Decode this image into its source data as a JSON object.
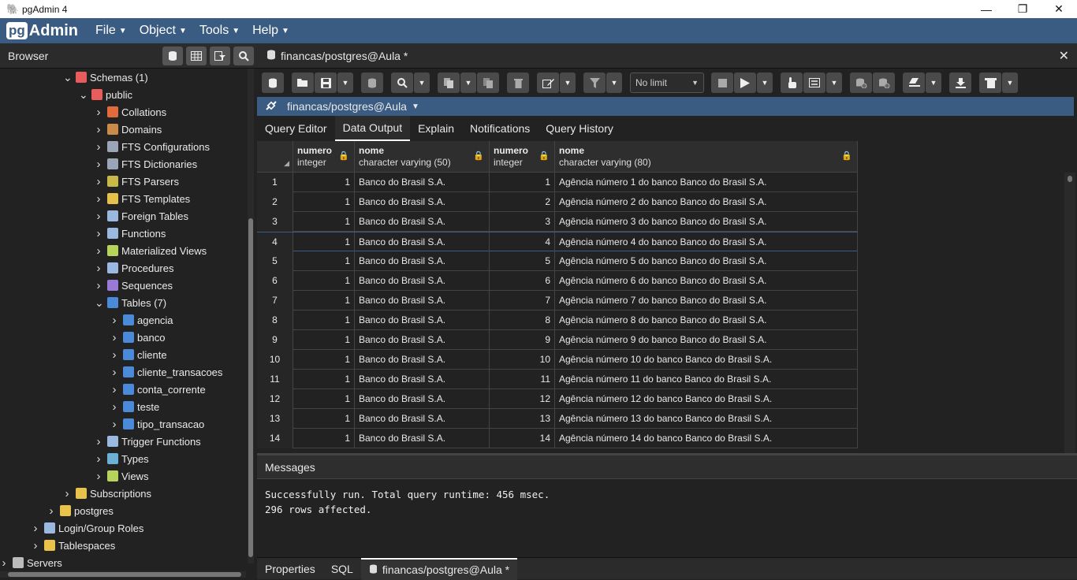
{
  "window": {
    "title": "pgAdmin 4",
    "minimize": "—",
    "restore": "❐",
    "close": "✕"
  },
  "app": {
    "logo_pg": "pg",
    "logo_admin": "Admin"
  },
  "menu": [
    {
      "label": "File"
    },
    {
      "label": "Object"
    },
    {
      "label": "Tools"
    },
    {
      "label": "Help"
    }
  ],
  "browser": {
    "title": "Browser",
    "tree": [
      {
        "label": "Schemas (1)",
        "depth": 4,
        "expanded": true,
        "icon": "schemas-icon"
      },
      {
        "label": "public",
        "depth": 5,
        "expanded": true,
        "icon": "schema-icon"
      },
      {
        "label": "Collations",
        "depth": 6,
        "expanded": false,
        "icon": "collations-icon"
      },
      {
        "label": "Domains",
        "depth": 6,
        "expanded": false,
        "icon": "domains-icon"
      },
      {
        "label": "FTS Configurations",
        "depth": 6,
        "expanded": false,
        "icon": "fts-configurations-icon"
      },
      {
        "label": "FTS Dictionaries",
        "depth": 6,
        "expanded": false,
        "icon": "fts-dictionaries-icon"
      },
      {
        "label": "FTS Parsers",
        "depth": 6,
        "expanded": false,
        "icon": "fts-parsers-icon"
      },
      {
        "label": "FTS Templates",
        "depth": 6,
        "expanded": false,
        "icon": "fts-templates-icon"
      },
      {
        "label": "Foreign Tables",
        "depth": 6,
        "expanded": false,
        "icon": "foreign-tables-icon"
      },
      {
        "label": "Functions",
        "depth": 6,
        "expanded": false,
        "icon": "functions-icon"
      },
      {
        "label": "Materialized Views",
        "depth": 6,
        "expanded": false,
        "icon": "materialized-views-icon"
      },
      {
        "label": "Procedures",
        "depth": 6,
        "expanded": false,
        "icon": "procedures-icon"
      },
      {
        "label": "Sequences",
        "depth": 6,
        "expanded": false,
        "icon": "sequences-icon"
      },
      {
        "label": "Tables (7)",
        "depth": 6,
        "expanded": true,
        "icon": "tables-icon"
      },
      {
        "label": "agencia",
        "depth": 7,
        "expanded": false,
        "icon": "table-icon"
      },
      {
        "label": "banco",
        "depth": 7,
        "expanded": false,
        "icon": "table-icon"
      },
      {
        "label": "cliente",
        "depth": 7,
        "expanded": false,
        "icon": "table-icon"
      },
      {
        "label": "cliente_transacoes",
        "depth": 7,
        "expanded": false,
        "icon": "table-icon"
      },
      {
        "label": "conta_corrente",
        "depth": 7,
        "expanded": false,
        "icon": "table-icon"
      },
      {
        "label": "teste",
        "depth": 7,
        "expanded": false,
        "icon": "table-icon"
      },
      {
        "label": "tipo_transacao",
        "depth": 7,
        "expanded": false,
        "icon": "table-icon"
      },
      {
        "label": "Trigger Functions",
        "depth": 6,
        "expanded": false,
        "icon": "trigger-functions-icon"
      },
      {
        "label": "Types",
        "depth": 6,
        "expanded": false,
        "icon": "types-icon"
      },
      {
        "label": "Views",
        "depth": 6,
        "expanded": false,
        "icon": "views-icon"
      },
      {
        "label": "Subscriptions",
        "depth": 4,
        "expanded": false,
        "icon": "subscriptions-icon"
      },
      {
        "label": "postgres",
        "depth": 3,
        "expanded": false,
        "icon": "database-icon"
      },
      {
        "label": "Login/Group Roles",
        "depth": 2,
        "expanded": false,
        "icon": "roles-icon"
      },
      {
        "label": "Tablespaces",
        "depth": 2,
        "expanded": false,
        "icon": "tablespaces-icon"
      },
      {
        "label": "Servers",
        "depth": 0,
        "expanded": false,
        "icon": "servers-icon"
      }
    ]
  },
  "query_tab": {
    "label": "financas/postgres@Aula *"
  },
  "toolbar": {
    "limit": "No limit"
  },
  "connection": {
    "label": "financas/postgres@Aula"
  },
  "subtabs": [
    {
      "label": "Query Editor"
    },
    {
      "label": "Data Output",
      "active": true
    },
    {
      "label": "Explain"
    },
    {
      "label": "Notifications"
    },
    {
      "label": "Query History"
    }
  ],
  "grid": {
    "columns": [
      {
        "name": "numero",
        "type": "integer"
      },
      {
        "name": "nome",
        "type": "character varying (50)"
      },
      {
        "name": "numero",
        "type": "integer"
      },
      {
        "name": "nome",
        "type": "character varying (80)"
      }
    ],
    "rows": [
      [
        "1",
        "1",
        "Banco do Brasil S.A.",
        "1",
        "Agência número 1 do banco Banco do Brasil S.A."
      ],
      [
        "2",
        "1",
        "Banco do Brasil S.A.",
        "2",
        "Agência número 2 do banco Banco do Brasil S.A."
      ],
      [
        "3",
        "1",
        "Banco do Brasil S.A.",
        "3",
        "Agência número 3 do banco Banco do Brasil S.A."
      ],
      [
        "4",
        "1",
        "Banco do Brasil S.A.",
        "4",
        "Agência número 4 do banco Banco do Brasil S.A."
      ],
      [
        "5",
        "1",
        "Banco do Brasil S.A.",
        "5",
        "Agência número 5 do banco Banco do Brasil S.A."
      ],
      [
        "6",
        "1",
        "Banco do Brasil S.A.",
        "6",
        "Agência número 6 do banco Banco do Brasil S.A."
      ],
      [
        "7",
        "1",
        "Banco do Brasil S.A.",
        "7",
        "Agência número 7 do banco Banco do Brasil S.A."
      ],
      [
        "8",
        "1",
        "Banco do Brasil S.A.",
        "8",
        "Agência número 8 do banco Banco do Brasil S.A."
      ],
      [
        "9",
        "1",
        "Banco do Brasil S.A.",
        "9",
        "Agência número 9 do banco Banco do Brasil S.A."
      ],
      [
        "10",
        "1",
        "Banco do Brasil S.A.",
        "10",
        "Agência número 10 do banco Banco do Brasil S.A."
      ],
      [
        "11",
        "1",
        "Banco do Brasil S.A.",
        "11",
        "Agência número 11 do banco Banco do Brasil S.A."
      ],
      [
        "12",
        "1",
        "Banco do Brasil S.A.",
        "12",
        "Agência número 12 do banco Banco do Brasil S.A."
      ],
      [
        "13",
        "1",
        "Banco do Brasil S.A.",
        "13",
        "Agência número 13 do banco Banco do Brasil S.A."
      ],
      [
        "14",
        "1",
        "Banco do Brasil S.A.",
        "14",
        "Agência número 14 do banco Banco do Brasil S.A."
      ]
    ]
  },
  "messages": {
    "title": "Messages",
    "lines": [
      "Successfully run. Total query runtime: 456 msec.",
      "296 rows affected."
    ]
  },
  "bottom_tabs": [
    {
      "label": "Properties"
    },
    {
      "label": "SQL"
    },
    {
      "label": "financas/postgres@Aula *",
      "active": true
    }
  ],
  "colors": {
    "accent": "#3a5b82",
    "background": "#222222"
  }
}
